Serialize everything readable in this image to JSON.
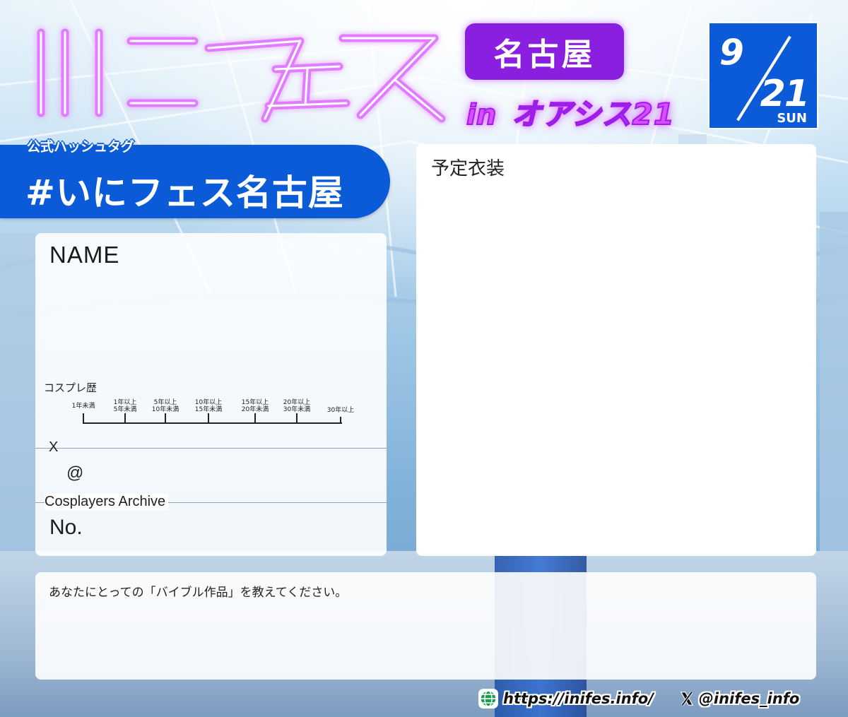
{
  "header": {
    "logo_text": "いにフェス",
    "venue": "名古屋",
    "venue_in": "in",
    "venue_place": "オアシス21",
    "date": {
      "month": "9",
      "day": "21",
      "weekday": "SUN"
    }
  },
  "hashtag": {
    "label": "公式ハッシュタグ",
    "tag": "#いにフェス名古屋"
  },
  "name_panel": {
    "name_label": "NAME",
    "career_label": "コスプレ歴",
    "career_scale": [
      [
        "1年未満"
      ],
      [
        "1年以上",
        "5年未満"
      ],
      [
        "5年以上",
        "10年未満"
      ],
      [
        "10年以上",
        "15年未満"
      ],
      [
        "15年以上",
        "20年未満"
      ],
      [
        "20年以上",
        "30年未満"
      ],
      [
        "30年以上"
      ]
    ],
    "x_label": "X",
    "at_label": "@",
    "archive_label": "Cosplayers Archive",
    "no_label": "No."
  },
  "costume_panel": {
    "label": "予定衣装"
  },
  "bible_panel": {
    "label": "あなたにとっての「バイブル作品」を教えてください。"
  },
  "footer": {
    "url": "https://inifes.info/",
    "handle": "@inifes_info"
  },
  "colors": {
    "brand_blue": "#0b5bd8",
    "neon_purple": "#d94cff",
    "badge_purple": "#8a1fe0"
  }
}
